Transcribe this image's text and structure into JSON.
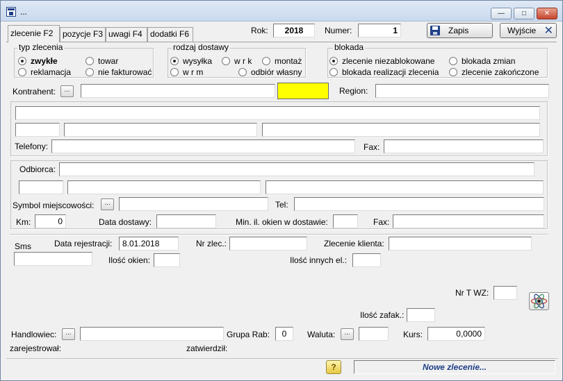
{
  "window": {
    "title": "...",
    "controls": {
      "minimize": "—",
      "maximize": "□",
      "close": "✕"
    }
  },
  "tabs": [
    {
      "label": "zlecenie F2",
      "active": true
    },
    {
      "label": "pozycje F3",
      "active": false
    },
    {
      "label": "uwagi F4",
      "active": false
    },
    {
      "label": "dodatki F6",
      "active": false
    }
  ],
  "header": {
    "rok_label": "Rok:",
    "rok_value": "2018",
    "numer_label": "Numer:",
    "numer_value": "1",
    "save_label": "Zapis",
    "exit_label": "Wyjście"
  },
  "typ_zlecenia": {
    "title": "typ zlecenia",
    "options": [
      {
        "label": "zwykłe",
        "selected": true
      },
      {
        "label": "towar",
        "selected": false
      },
      {
        "label": "reklamacja",
        "selected": false
      },
      {
        "label": "nie fakturować",
        "selected": false
      }
    ]
  },
  "rodzaj_dostawy": {
    "title": "rodzaj dostawy",
    "options": [
      {
        "label": "wysyłka",
        "selected": true
      },
      {
        "label": "w r k",
        "selected": false
      },
      {
        "label": "montaż",
        "selected": false
      },
      {
        "label": "w r m",
        "selected": false
      },
      {
        "label": "odbiór własny",
        "selected": false
      }
    ]
  },
  "blokada": {
    "title": "blokada",
    "options": [
      {
        "label": "zlecenie niezablokowane",
        "selected": true
      },
      {
        "label": "blokada zmian",
        "selected": false
      },
      {
        "label": "blokada realizacji zlecenia",
        "selected": false
      },
      {
        "label": "zlecenie zakończone",
        "selected": false
      }
    ]
  },
  "kontrahent": {
    "label": "Kontrahent:",
    "browse": "...",
    "value": "",
    "code_value": "",
    "highlight_color": "#ffff00",
    "region_label": "Region:",
    "region_value": ""
  },
  "address": {
    "name": "",
    "postcode": "",
    "city": "",
    "street": "",
    "telefony_label": "Telefony:",
    "telefony_value": "",
    "fax_label": "Fax:",
    "fax_value": ""
  },
  "odbiorca": {
    "label": "Odbiorca:",
    "value": "",
    "postcode": "",
    "city": "",
    "street": "",
    "symbol_label": "Symbol miejscowości:",
    "symbol_browse": "...",
    "symbol_value": "",
    "tel_label": "Tel:",
    "tel_value": "",
    "km_label": "Km:",
    "km_value": "0",
    "data_dostawy_label": "Data dostawy:",
    "data_dostawy_value": "",
    "min_okien_label": "Min. il. okien w dostawie:",
    "min_okien_value": "",
    "fax_label": "Fax:",
    "fax_value": ""
  },
  "details": {
    "sms_label": "Sms",
    "sms_value": "",
    "data_rej_label": "Data rejestracji:",
    "data_rej_value": "8.01.2018",
    "nr_zlec_label": "Nr zlec.:",
    "nr_zlec_value": "",
    "zlecenie_klienta_label": "Zlecenie klienta:",
    "zlecenie_klienta_value": "",
    "ilosc_okien_label": "Ilość okien:",
    "ilosc_okien_value": "",
    "ilosc_innych_label": "Ilość innych el.:",
    "ilosc_innych_value": "",
    "nr_twz_label": "Nr T WZ:",
    "nr_twz_value": "",
    "ilosc_zafak_label": "Ilość zafak.:",
    "ilosc_zafak_value": ""
  },
  "footer": {
    "handlowiec_label": "Handlowiec:",
    "handlowiec_browse": "...",
    "handlowiec_value": "",
    "grupa_rab_label": "Grupa Rab:",
    "grupa_rab_value": "0",
    "waluta_label": "Waluta:",
    "waluta_browse": "...",
    "waluta_value": "",
    "kurs_label": "Kurs:",
    "kurs_value": "0,0000",
    "zarejestrowal_label": "zarejestrował:",
    "zatwierdzil_label": "zatwierdził:"
  },
  "status": {
    "help_label": "?",
    "message": "Nowe zlecenie..."
  },
  "icons": {
    "app": "app-form-icon",
    "save": "floppy-disk-icon",
    "exit": "close-x-icon",
    "atom": "atom-icon",
    "help": "question-mark-icon"
  },
  "colors": {
    "accent": "#1f3f86",
    "highlight_field": "#ffff00",
    "status_text": "#1f3f86"
  }
}
